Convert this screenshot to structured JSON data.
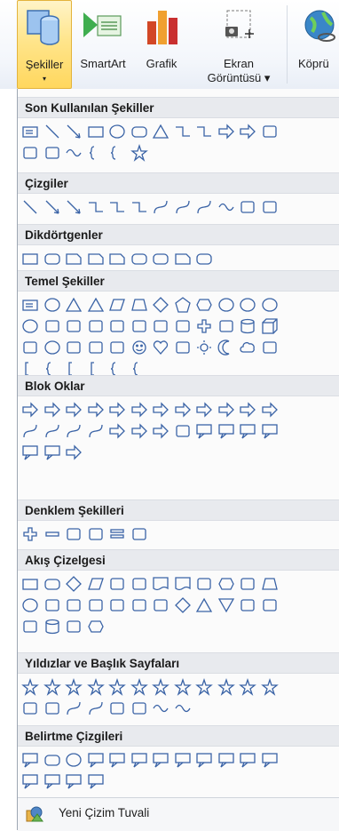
{
  "ribbon": {
    "buttons": [
      {
        "label": "Şekiller",
        "label2": "▾",
        "icon": "shapes-icon"
      },
      {
        "label": "SmartArt",
        "label2": "",
        "icon": "smartart-icon"
      },
      {
        "label": "Grafik",
        "label2": "",
        "icon": "chart-icon"
      },
      {
        "label": "Ekran",
        "label2": "Görüntüsü ▾",
        "icon": "screenshot-icon"
      },
      {
        "label": "Köprü",
        "label2": "",
        "icon": "hyperlink-icon"
      }
    ]
  },
  "gallery": {
    "sections": [
      {
        "title": "Son Kullanılan Şekiller",
        "rows": [
          [
            "textbox",
            "line",
            "arrow-line",
            "rect",
            "ellipse",
            "rounded-rect",
            "triangle",
            "elbow",
            "elbow-arrow",
            "right-arrow",
            "down-arrow",
            "flowchart-tape"
          ],
          [
            "freeform",
            "arc",
            "wave",
            "left-brace",
            "right-brace",
            "star5"
          ]
        ]
      },
      {
        "title": "Çizgiler",
        "rows": [
          [
            "line",
            "arrow-line",
            "double-arrow-line",
            "elbow",
            "elbow-arrow",
            "elbow-double-arrow",
            "curve",
            "curve-arrow",
            "curve-double-arrow",
            "wave",
            "flowchart-tape",
            "freeform"
          ]
        ]
      },
      {
        "title": "Dikdörtgenler",
        "rows": [
          [
            "rect",
            "rounded-rect",
            "snip1",
            "snip2",
            "snip-round",
            "round1",
            "round2",
            "snip-diag",
            "round-diag"
          ]
        ]
      },
      {
        "title": "Temel Şekiller",
        "rows": [
          [
            "textbox",
            "ellipse",
            "triangle",
            "right-triangle",
            "parallelogram",
            "trapezoid",
            "diamond",
            "pentagon",
            "hexagon",
            "circle7",
            "circle8",
            "circle10"
          ],
          [
            "circle12",
            "pie",
            "chord",
            "teardrop",
            "frame",
            "half-frame",
            "l-shape",
            "diag-stripe",
            "cross",
            "plaque",
            "can",
            "cube"
          ],
          [
            "bevel",
            "donut",
            "no-symbol",
            "block-arc",
            "folded-corner",
            "smiley",
            "heart",
            "lightning",
            "sun",
            "moon",
            "cloud",
            "arc"
          ],
          [
            "bracket-pair",
            "brace-pair",
            "left-bracket",
            "right-bracket",
            "left-brace",
            "right-brace"
          ]
        ]
      },
      {
        "title": "Blok Oklar",
        "rows": [
          [
            "right-arrow",
            "left-arrow",
            "up-arrow",
            "down-arrow",
            "left-right-arrow",
            "up-down-arrow",
            "quad-arrow",
            "left-right-up-arrow",
            "bent-arrow",
            "u-turn-arrow",
            "left-up-arrow",
            "bent-up-arrow"
          ],
          [
            "curved-right-arrow",
            "curved-left-arrow",
            "curved-up-arrow",
            "curved-down-arrow",
            "striped-arrow",
            "notched-arrow",
            "pentagon-arrow",
            "chevron",
            "right-callout",
            "down-callout",
            "left-callout",
            "up-callout"
          ],
          [
            "left-right-callout",
            "quad-callout",
            "circular-arrow"
          ]
        ]
      },
      {
        "title": "Denklem Şekilleri",
        "rows": [
          [
            "plus",
            "minus",
            "multiply",
            "divide",
            "equal",
            "not-equal"
          ]
        ]
      },
      {
        "title": "Akış Çizelgesi",
        "rows": [
          [
            "process",
            "alt-process",
            "decision",
            "data",
            "predefined",
            "internal-storage",
            "document",
            "multidoc",
            "terminator",
            "preparation",
            "manual-input",
            "manual-op"
          ],
          [
            "connector",
            "offpage",
            "card",
            "punched-tape",
            "summing",
            "or",
            "collate",
            "sort",
            "extract",
            "merge",
            "stored-data",
            "delay"
          ],
          [
            "sequential",
            "magnetic-disk",
            "direct-access",
            "display"
          ]
        ]
      },
      {
        "title": "Yıldızlar ve Başlık Sayfaları",
        "rows": [
          [
            "explosion1",
            "explosion2",
            "star4",
            "star5",
            "star6",
            "star7",
            "star8",
            "star10",
            "star12",
            "star16",
            "star24",
            "star32"
          ],
          [
            "ribbon-up",
            "ribbon-down",
            "curved-ribbon-up",
            "curved-ribbon-down",
            "vertical-scroll",
            "horizontal-scroll",
            "wave",
            "double-wave"
          ]
        ]
      },
      {
        "title": "Belirtme Çizgileri",
        "rows": [
          [
            "rect-callout",
            "roundrect-callout",
            "oval-callout",
            "cloud-callout",
            "line-callout1",
            "line-callout2",
            "line-callout3",
            "line-callout1-accent",
            "line-callout2-accent",
            "line-callout3-accent",
            "line-callout1-border",
            "line-callout2-border"
          ],
          [
            "line-callout3-border",
            "line-callout1-accent-border",
            "line-callout2-accent-border",
            "line-callout3-accent-border"
          ]
        ]
      }
    ],
    "footer_label": "Yeni Çizim Tuvali"
  }
}
